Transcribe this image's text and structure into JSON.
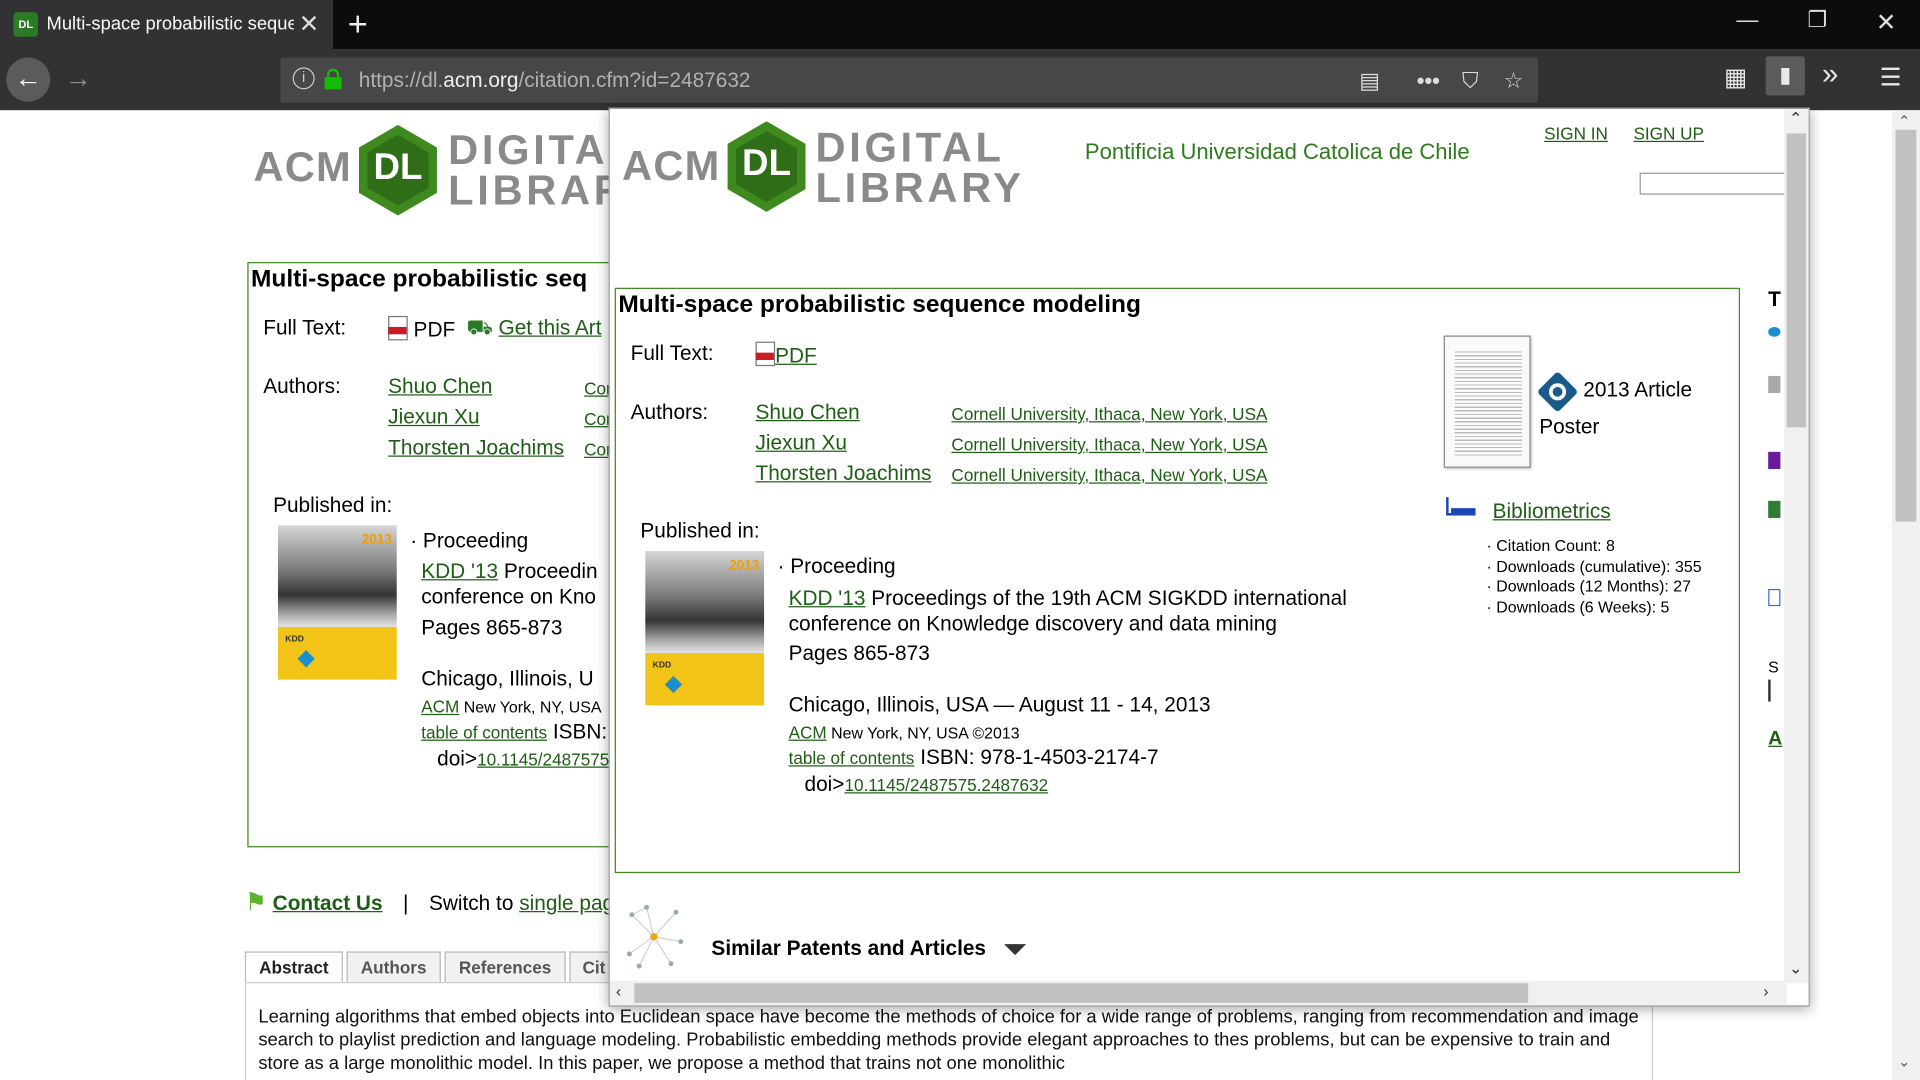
{
  "browser": {
    "tab_title": "Multi-space probabilistic seque",
    "favicon_text": "DL",
    "url_prefix": "https://dl.",
    "url_domain": "acm.org",
    "url_path": "/citation.cfm?id=2487632"
  },
  "logo": {
    "acm": "ACM",
    "dl": "DL",
    "digital": "DIGITAL",
    "library": "LIBRARY"
  },
  "header": {
    "institution": "Pontificia Universidad Catolica de Chile",
    "sign_in": "SIGN IN",
    "sign_up": "SIGN UP"
  },
  "article": {
    "title": "Multi-space probabilistic sequence modeling",
    "full_text_label": "Full Text:",
    "pdf_label": "PDF",
    "get_this_article": "Get this Art",
    "authors_label": "Authors:",
    "authors": [
      {
        "name": "Shuo Chen",
        "affiliation": "Cornell University, Ithaca, New York, USA"
      },
      {
        "name": "Jiexun Xu",
        "affiliation": "Cornell University, Ithaca, New York, USA"
      },
      {
        "name": "Thorsten Joachims",
        "affiliation": "Cornell University, Ithaca, New York, USA"
      }
    ],
    "published_in_label": "Published in:",
    "bullet_type": "Proceeding",
    "conf_abbrev": "KDD '13",
    "conf_name": "Proceedings of the 19th ACM SIGKDD international conference on Knowledge discovery and data mining",
    "pages": "Pages 865-873",
    "location": "Chicago, Illinois, USA — August 11 - 14, 2013",
    "publisher": "ACM",
    "publisher_loc": "New York, NY, USA ©2013",
    "toc": "table of contents",
    "isbn": "ISBN: 978-1-4503-2174-7",
    "doi_label": "doi>",
    "doi": "10.1145/2487575.2487632",
    "cover_year": "2013",
    "cover_kdd": "KDD"
  },
  "sidebar": {
    "article_year": "2013 Article",
    "poster": "Poster",
    "bibliometrics": "Bibliometrics",
    "stats": [
      "Citation Count: 8",
      "Downloads (cumulative): 355",
      "Downloads (12 Months): 27",
      "Downloads (6 Weeks): 5"
    ]
  },
  "similar": "Similar Patents and Articles",
  "background": {
    "title": "Multi-space probabilistic seq",
    "location": "Chicago, Illinois, U",
    "publisher_loc": "New York, NY, USA",
    "isbn": "ISBN:",
    "doi": "10.1145/2487575",
    "conf_name_line1": "Proceedin",
    "conf_name_line2": "conference on Kno",
    "contact": "Contact Us",
    "switch_text": "Switch to",
    "switch_link": "single pag",
    "tabs": [
      "Abstract",
      "Authors",
      "References",
      "Cit"
    ],
    "abstract": "Learning algorithms that embed objects into Euclidean space have become the methods of choice for a wide range of problems, ranging from recommendation and image search to playlist prediction and language modeling. Probabilistic embedding methods provide elegant approaches to thes problems, but can be expensive to train and store as a large monolithic model. In this paper, we propose a method that trains not one monolithic"
  },
  "colors": {
    "accent_green": "#1d5e14",
    "border_green": "#3e8a1f",
    "chrome_dark": "#0c0c0d",
    "chrome_bar": "#323234"
  }
}
